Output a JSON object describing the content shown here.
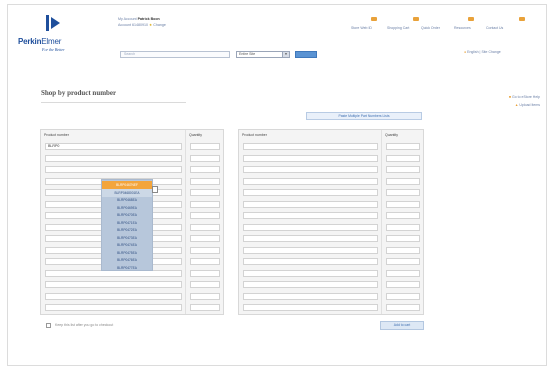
{
  "header": {
    "logo": {
      "brand_bold": "PerkinElmer",
      "tagline": "For the Better"
    },
    "account": {
      "line1_prefix": "My Account",
      "user_name": "Patrick Boon",
      "line2_prefix": "Account",
      "account_number": "61480910",
      "change_link": "Change"
    },
    "top_links": [
      "Store Web ID",
      "Shopping Cart",
      "Quick Order",
      "Resources",
      "Contact Us"
    ],
    "search": {
      "placeholder": "Search",
      "category_value": "Entire Site",
      "go_label": ""
    },
    "language": "English | Site Change"
  },
  "page": {
    "title": "Shop by product number",
    "right_links": [
      "Go to eStore Help",
      "Upload Items"
    ],
    "paste_button": "Paste Multiple Part Numbers Lists"
  },
  "order_form": {
    "left_headers": {
      "product": "Product number",
      "quantity": "Quantity"
    },
    "right_headers": {
      "product": "Product number",
      "quantity": "Quantity"
    },
    "typed_value": "BLRP0",
    "autocomplete": {
      "highlighted": "BLRP0467NEF",
      "items": [
        "BLRP0467NEF",
        "BLRP0468001EA",
        "BLRP0468EA",
        "BLRP0469EA",
        "BLRP0470EA",
        "BLRP0471EA",
        "BLRP0472EA",
        "BLRP0473EA",
        "BLRP0474EA",
        "BLRP0475EA",
        "BLRP0476EA",
        "BLRP0477EA"
      ]
    },
    "save_checkbox_label": "Keep this list after you go to checkout",
    "add_to_cart": "Add to cart"
  },
  "colors": {
    "brand_blue": "#1f4f9c",
    "accent_orange": "#f3a53c",
    "dropdown_bg": "#b7c7db",
    "link_blue": "#6a7fa6"
  }
}
